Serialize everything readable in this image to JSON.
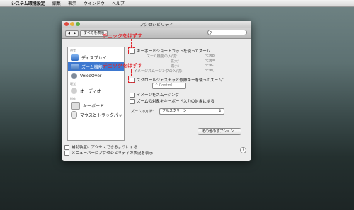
{
  "menubar": {
    "apple": "",
    "items": [
      "システム環境設定",
      "編集",
      "表示",
      "ウインドウ",
      "ヘルプ"
    ]
  },
  "window": {
    "title": "アクセシビリティ"
  },
  "toolbar": {
    "back": "◀",
    "forward": "▶",
    "show_all": "すべてを表示",
    "search_placeholder": ""
  },
  "sidebar": {
    "sections": [
      "視覚",
      "聴覚",
      "操作"
    ],
    "items": [
      {
        "label": "ディスプレイ",
        "icon": "display-icon"
      },
      {
        "label": "ズーム機能",
        "icon": "zoom-icon",
        "selected": true
      },
      {
        "label": "VoiceOver",
        "icon": "voiceover-icon"
      },
      {
        "label": "オーディオ",
        "icon": "speaker-icon"
      },
      {
        "label": "キーボード",
        "icon": "keyboard-icon"
      },
      {
        "label": "マウスとトラックパッ",
        "icon": "mouse-icon"
      }
    ]
  },
  "panel": {
    "keyboard_shortcut": {
      "label": "キーボードショートカットを使ってズーム",
      "checked": false
    },
    "shortcuts": [
      {
        "label": "ズーム機能の入/切：",
        "key": "⌥⌘8"
      },
      {
        "label": "拡大：",
        "key": "⌥⌘="
      },
      {
        "label": "縮小：",
        "key": "⌥⌘-"
      },
      {
        "label": "イメージスムージングの入/切：",
        "key": "⌥⌘\\"
      }
    ],
    "scroll_gesture": {
      "label": "スクロールジェスチャと修飾キーを使ってズーム：",
      "checked": false
    },
    "modifier_popup": "^ Control",
    "smooth_images": "イメージをスムージング",
    "follow_focus": "ズームの対象をキーボード入力の対象にする",
    "zoom_style_label": "ズームの方法：",
    "zoom_style_value": "フルスクリーン",
    "more_options": "その他のオプション..."
  },
  "footer": {
    "menu_shortcut": "補助装置にアクセスできるようにする",
    "menu_status": "メニューバーにアクセシビリティの状況を表示",
    "help": "?"
  },
  "annotations": {
    "callout_1": "チェックをはずす",
    "callout_2": "チェックをはずす",
    "color": "#e0242b"
  }
}
